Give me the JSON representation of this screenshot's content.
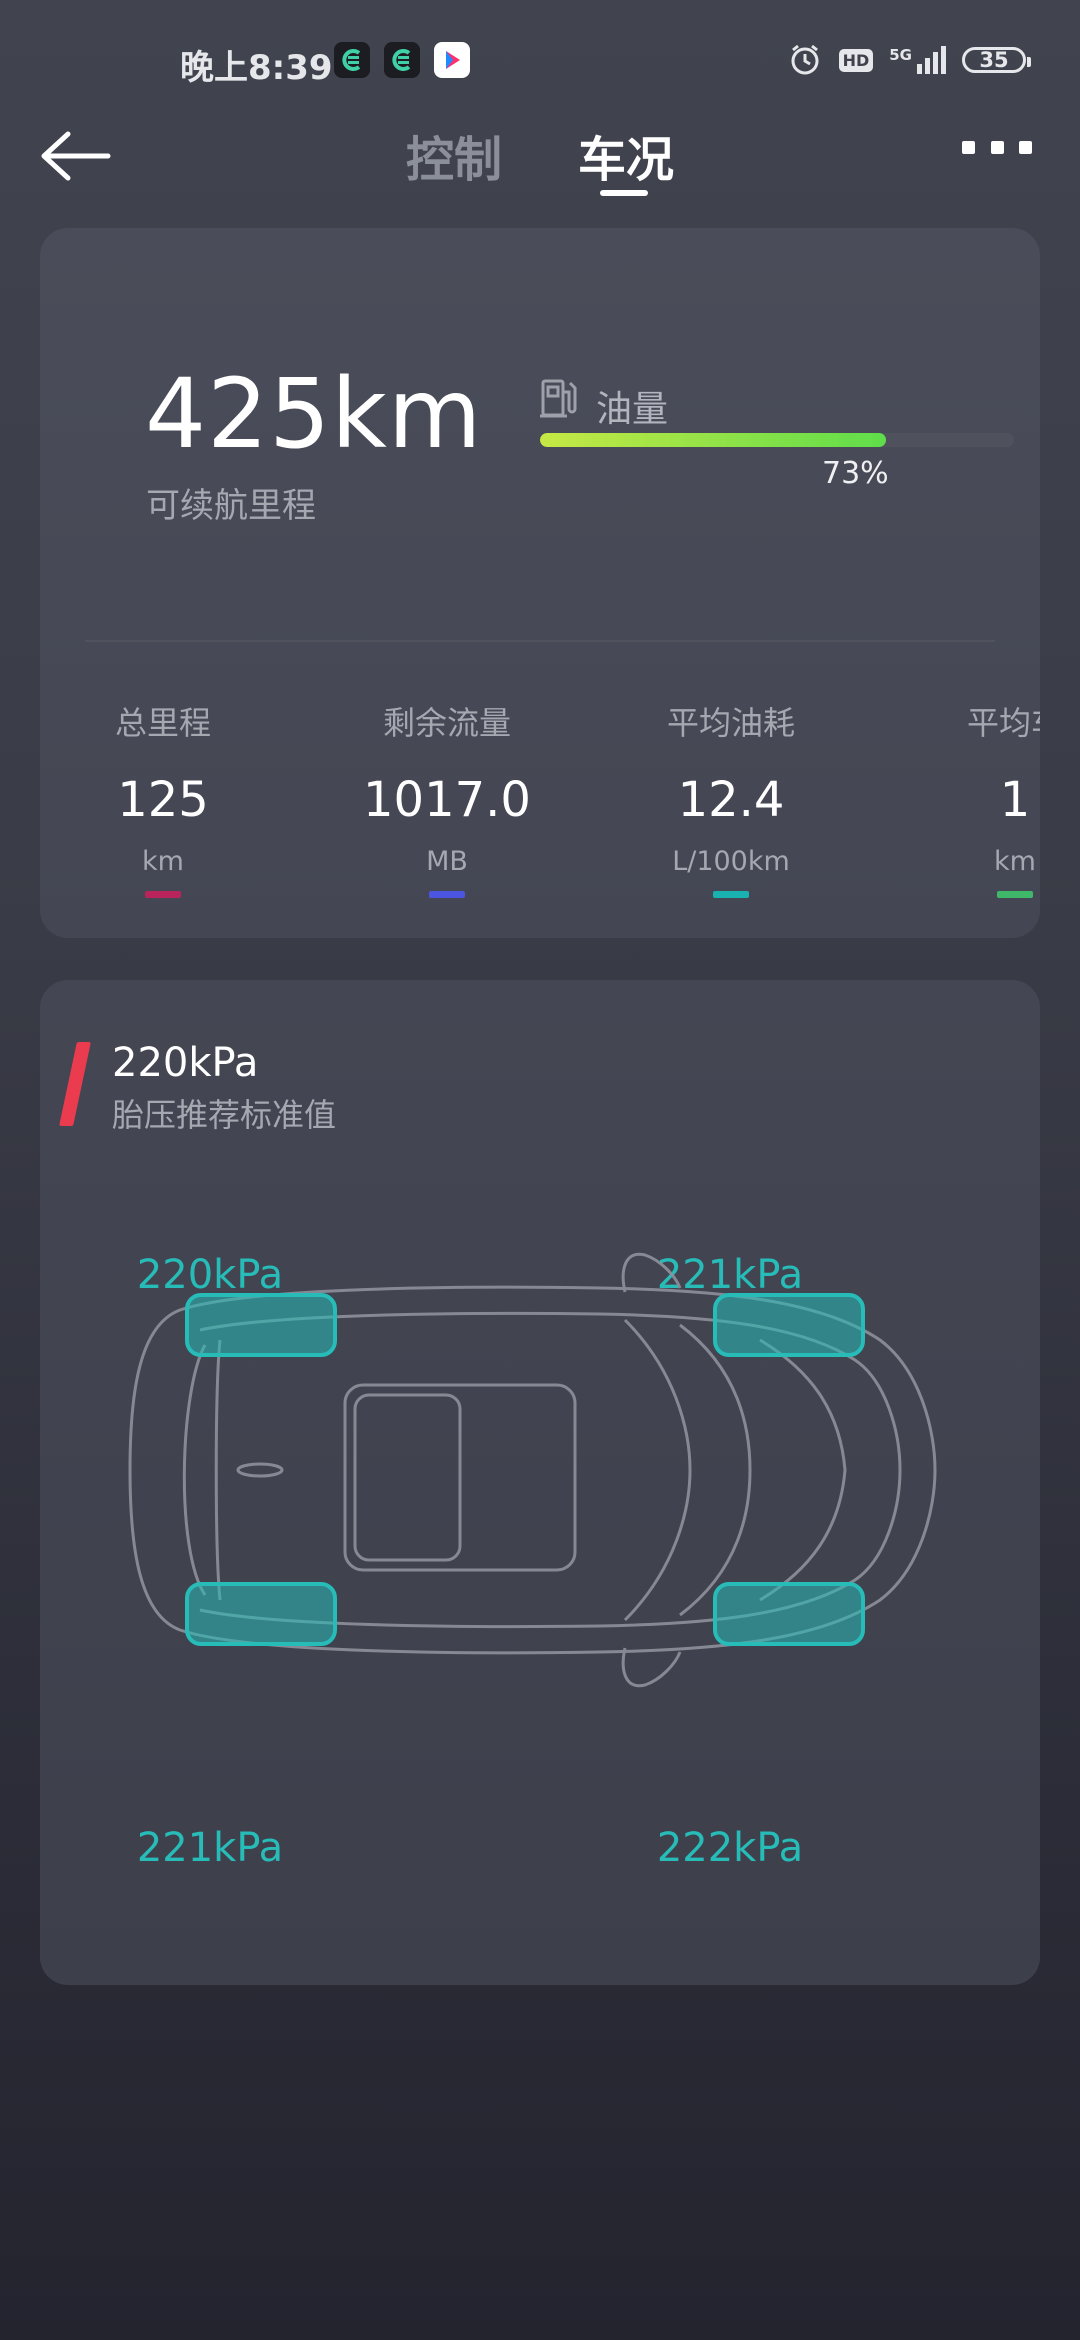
{
  "status_bar": {
    "time": "晚上8:39",
    "network": "5G",
    "hd": "HD",
    "battery": "35",
    "icons": [
      "notification-app-icon",
      "notification-app-icon",
      "youku-app-icon",
      "alarm-icon",
      "hd-icon",
      "signal-icon",
      "battery-icon"
    ]
  },
  "header": {
    "tabs": [
      {
        "label": "控制",
        "active": false
      },
      {
        "label": "车况",
        "active": true
      }
    ],
    "back_icon": "back-arrow-icon",
    "more_icon": "more-icon"
  },
  "range_card": {
    "range_value": "425km",
    "range_label": "可续航里程",
    "fuel_icon": "fuel-pump-icon",
    "fuel_label": "油量",
    "fuel_percent_text": "73%",
    "fuel_level": 0.73,
    "stats": [
      {
        "label": "总里程",
        "value": "125",
        "unit": "km",
        "color": "#b8245b"
      },
      {
        "label": "剩余流量",
        "value": "1017.0",
        "unit": "MB",
        "color": "#4b55e2"
      },
      {
        "label": "平均油耗",
        "value": "12.4",
        "unit": "L/100km",
        "color": "#19b2b0"
      },
      {
        "label": "平均车",
        "value": "1",
        "unit": "km",
        "color": "#3fb86a"
      }
    ]
  },
  "tire_card": {
    "standard_value": "220kPa",
    "standard_label": "胎压推荐标准值",
    "tires": {
      "front_left": "220kPa",
      "front_right": "221kPa",
      "rear_left": "221kPa",
      "rear_right": "222kPa"
    },
    "tire_color": "#27bcb8"
  }
}
